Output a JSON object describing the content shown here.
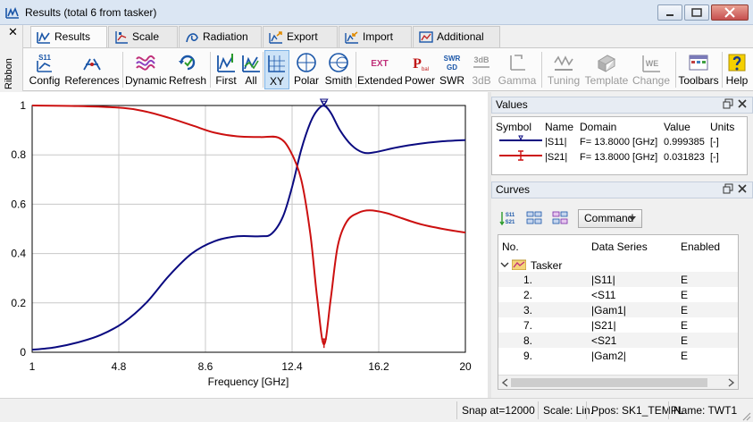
{
  "window": {
    "title": "Results (total 6 from tasker)"
  },
  "ribbon": {
    "collapse_glyph": "✕",
    "label": "Ribbon"
  },
  "tabs": [
    {
      "label": "Results",
      "icon": "results-icon",
      "active": true
    },
    {
      "label": "Scale",
      "icon": "scale-icon"
    },
    {
      "label": "Radiation",
      "icon": "radiation-icon"
    },
    {
      "label": "Export",
      "icon": "export-icon"
    },
    {
      "label": "Import",
      "icon": "import-icon"
    },
    {
      "label": "Additional",
      "icon": "additional-icon"
    }
  ],
  "toolbar": {
    "config": "Config",
    "references": "References",
    "dynamic": "Dynamic",
    "refresh": "Refresh",
    "first": "First",
    "all": "All",
    "xy": "XY",
    "polar": "Polar",
    "smith": "Smith",
    "extended": "Extended",
    "power": "Power",
    "swr": "SWR",
    "db3": "3dB",
    "gamma": "Gamma",
    "tuning": "Tuning",
    "template": "Template",
    "change": "Change",
    "toolbars": "Toolbars",
    "help": "Help",
    "icon_text": {
      "config": "S11",
      "extended": "EXT",
      "power_main": "P",
      "power_sub": "bal",
      "swr_top": "SWR",
      "swr_bottom": "GD",
      "db3": "3dB",
      "tuning": "TW",
      "change": "WE"
    }
  },
  "values_panel": {
    "title": "Values",
    "columns": [
      "Symbol",
      "Name",
      "Domain",
      "Value",
      "Units"
    ],
    "rows": [
      {
        "name": "|S11|",
        "domain": "F= 13.8000 [GHz]",
        "value": "0.999385",
        "units": "[-]",
        "color": "#0a0a80"
      },
      {
        "name": "|S21|",
        "domain": "F= 13.8000 [GHz]",
        "value": "0.031823",
        "units": "[-]",
        "color": "#cc1010"
      }
    ]
  },
  "curves_panel": {
    "title": "Curves",
    "command_label": "Command",
    "tool_icon_text": {
      "a_top": "S11",
      "a_bottom": "S21"
    },
    "columns": [
      "No.",
      "Data Series",
      "Enabled"
    ],
    "group": "Tasker",
    "rows": [
      {
        "no": "1.",
        "series": "|S11|",
        "enabled": "E"
      },
      {
        "no": "2.",
        "series": "<S11",
        "enabled": "E"
      },
      {
        "no": "3.",
        "series": "|Gam1|",
        "enabled": "E"
      },
      {
        "no": "7.",
        "series": "|S21|",
        "enabled": "E"
      },
      {
        "no": "8.",
        "series": "<S21",
        "enabled": "E"
      },
      {
        "no": "9.",
        "series": "|Gam2|",
        "enabled": "E"
      }
    ]
  },
  "status": {
    "snap": "Snap at=12000",
    "scale": "Scale: Lin.",
    "ppos": "Ppos: SK1_TEMPL",
    "name": "Name: TWT1"
  },
  "chart_data": {
    "type": "line",
    "xlabel": "Frequency [GHz]",
    "ylabel": "",
    "xlim": [
      1,
      20
    ],
    "ylim": [
      0,
      1
    ],
    "x_ticks": [
      1,
      4.8,
      8.6,
      12.4,
      16.2,
      20
    ],
    "x_tick_labels": [
      "1",
      "4.8",
      "8.6",
      "12.4",
      "16.2",
      "20"
    ],
    "y_ticks": [
      0,
      0.2,
      0.4,
      0.6,
      0.8,
      1
    ],
    "y_tick_labels": [
      "0",
      "0.2",
      "0.4",
      "0.6",
      "0.8",
      "1"
    ],
    "grid": true,
    "marker_x": 13.8,
    "series": [
      {
        "name": "|S11|",
        "color": "#0a0a80",
        "x": [
          1,
          2,
          3,
          4,
          5,
          6,
          7,
          8,
          9,
          10,
          11,
          11.5,
          12,
          12.4,
          12.8,
          13.2,
          13.5,
          13.8,
          14.1,
          14.5,
          15,
          15.5,
          16,
          17,
          18,
          19,
          20
        ],
        "y": [
          0.01,
          0.02,
          0.04,
          0.07,
          0.12,
          0.2,
          0.31,
          0.4,
          0.45,
          0.47,
          0.47,
          0.48,
          0.55,
          0.67,
          0.82,
          0.93,
          0.98,
          0.999,
          0.97,
          0.9,
          0.84,
          0.81,
          0.81,
          0.83,
          0.845,
          0.855,
          0.86
        ]
      },
      {
        "name": "|S21|",
        "color": "#cc1010",
        "x": [
          1,
          3,
          5,
          6,
          7,
          8,
          9,
          10,
          11,
          11.8,
          12.3,
          12.8,
          13.2,
          13.5,
          13.8,
          14.1,
          14.4,
          14.8,
          15.3,
          15.8,
          16.5,
          17,
          18,
          19,
          20
        ],
        "y": [
          1,
          0.998,
          0.99,
          0.975,
          0.95,
          0.92,
          0.89,
          0.875,
          0.872,
          0.87,
          0.82,
          0.7,
          0.48,
          0.22,
          0.032,
          0.22,
          0.43,
          0.53,
          0.565,
          0.575,
          0.565,
          0.55,
          0.52,
          0.5,
          0.485
        ]
      }
    ]
  }
}
